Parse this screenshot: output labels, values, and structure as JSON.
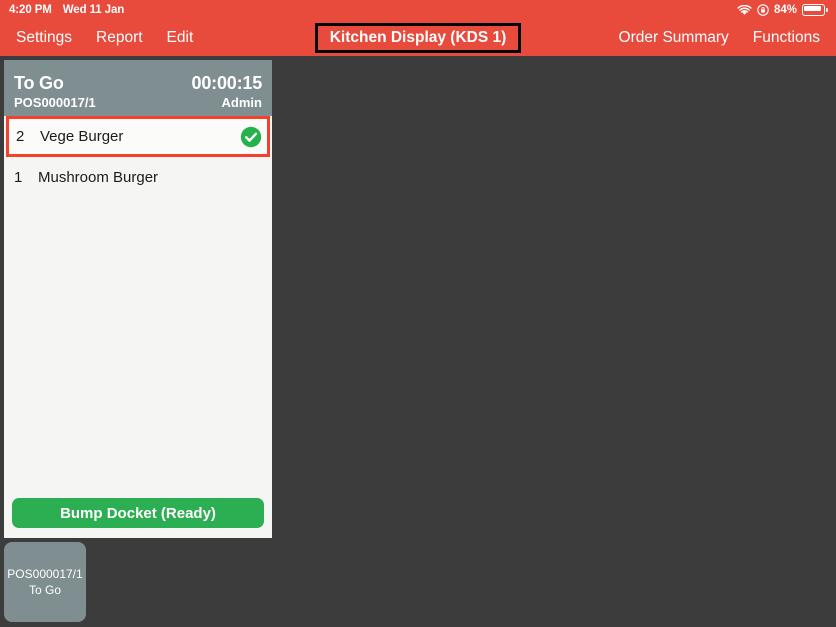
{
  "statusbar": {
    "time": "4:20 PM",
    "date": "Wed 11 Jan",
    "wifi_icon": "wifi-icon",
    "lock_icon": "rotation-lock-icon",
    "battery_percent": "84%",
    "battery_icon": "battery-icon"
  },
  "navbar": {
    "left_items": [
      {
        "label": "Settings"
      },
      {
        "label": "Report"
      },
      {
        "label": "Edit"
      }
    ],
    "title": "Kitchen Display (KDS 1)",
    "right_items": [
      {
        "label": "Order Summary"
      },
      {
        "label": "Functions"
      }
    ]
  },
  "docket": {
    "header": {
      "order_type": "To Go",
      "order_number": "POS000017/1",
      "timer": "00:00:15",
      "user": "Admin"
    },
    "items": [
      {
        "qty": "2",
        "name": "Vege Burger",
        "ready": true
      },
      {
        "qty": "1",
        "name": "Mushroom Burger",
        "ready": false
      }
    ],
    "bump_button_label": "Bump Docket (Ready)"
  },
  "tray": {
    "tiles": [
      {
        "order_number": "POS000017/1",
        "order_type": "To Go"
      }
    ]
  },
  "colors": {
    "accent_red": "#e84a3c",
    "highlight_red": "#f5402c",
    "background_dark": "#3c3c3c",
    "docket_header_grey": "#7f8e90",
    "docket_body": "#f5f5f3",
    "ready_green": "#2cae52"
  }
}
